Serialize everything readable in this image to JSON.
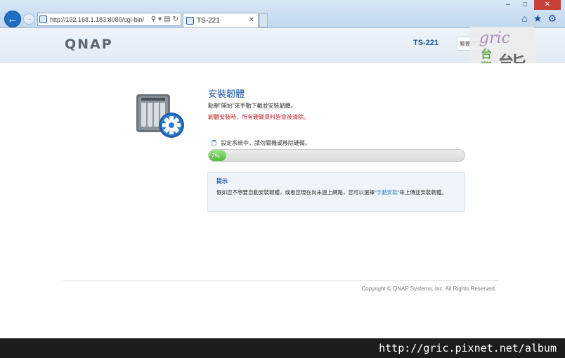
{
  "browser": {
    "address": "http://192.168.1.183:8080/cgi-bin/",
    "tab_title": "TS-221"
  },
  "header": {
    "logo": "QNAP",
    "model": "TS-221",
    "language": "繁體中文"
  },
  "watermark": {
    "brand": "gric",
    "region": "台灣",
    "mark": "熊"
  },
  "main": {
    "title": "安裝韌體",
    "description": "點擊\"開始\"來手動下載並安裝韌體。",
    "warning": "韌體安裝時，所有硬碟資料皆會被清除。",
    "status": "設定系統中，請勿關機或移除硬碟。",
    "progress_label": "7%",
    "progress_value": 0.07
  },
  "tip": {
    "title": "提示",
    "text_before": "假如您不想要自動安裝韌體，或者您現在尚未連上網路，您可以選擇\"",
    "link": "手動安裝",
    "text_after": "\"來上傳並安裝韌體。"
  },
  "footer": {
    "copyright": "Copyright © QNAP Systems, Inc. All Rights Reserved."
  },
  "banner": {
    "url": "http://gric.pixnet.net/album"
  },
  "colors": {
    "accent": "#1d5aa0",
    "warning": "#c0262c",
    "progress": "#4fbd3a"
  }
}
